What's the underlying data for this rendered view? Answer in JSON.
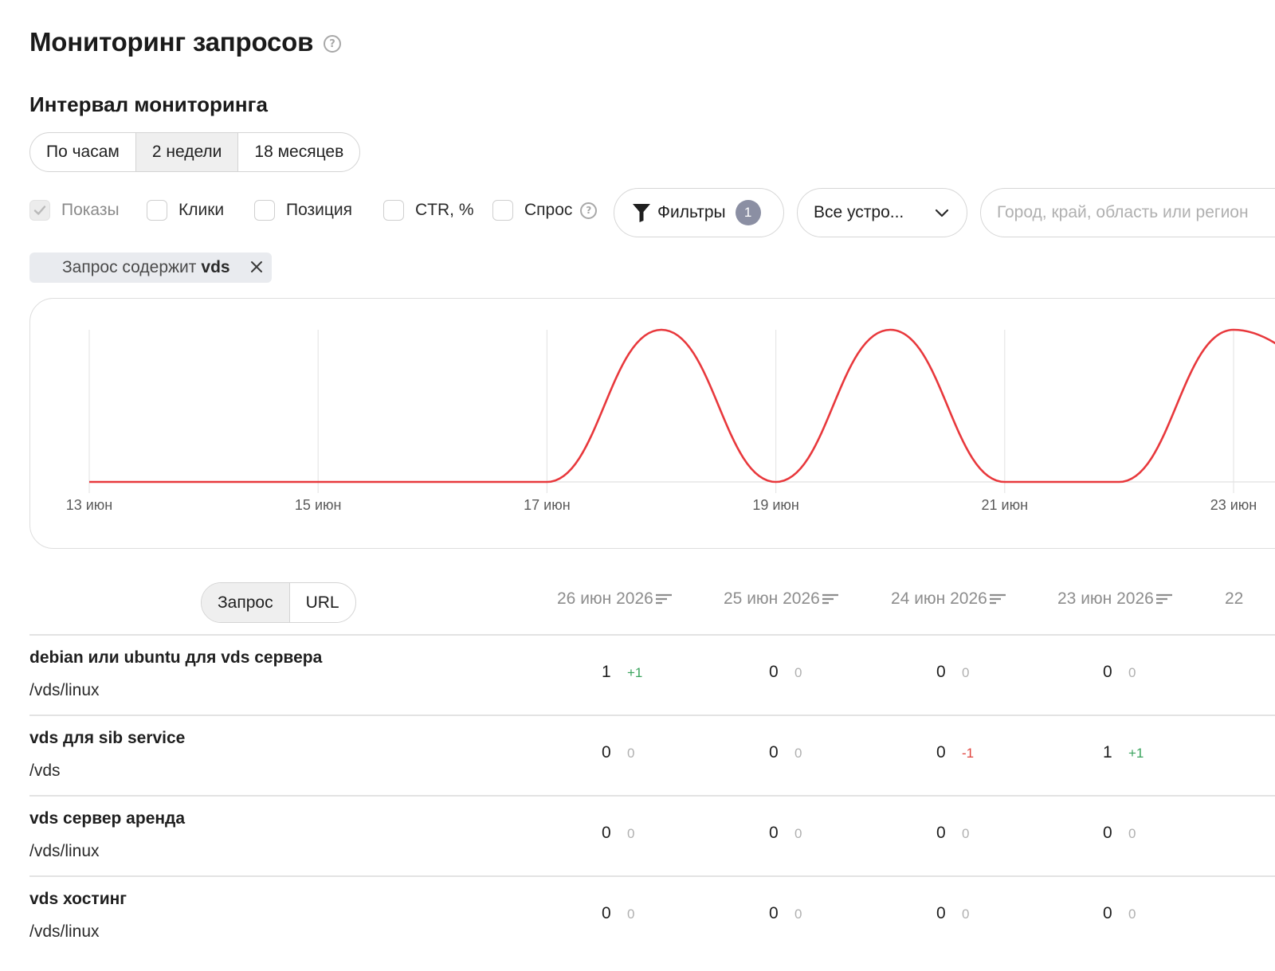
{
  "page": {
    "title": "Мониторинг запросов",
    "help_glyph": "?"
  },
  "interval": {
    "title": "Интервал мониторинга",
    "options": [
      "По часам",
      "2 недели",
      "18 месяцев"
    ],
    "selected": "2 недели"
  },
  "metrics": [
    {
      "label": "Показы",
      "checked": true,
      "disabled": true
    },
    {
      "label": "Клики",
      "checked": false
    },
    {
      "label": "Позиция",
      "checked": false
    },
    {
      "label": "CTR, %",
      "checked": false
    },
    {
      "label": "Спрос",
      "checked": false,
      "has_help": true
    }
  ],
  "filters": {
    "label": "Фильтры",
    "count": "1",
    "icon": "funnel-icon"
  },
  "devices": {
    "value": "Все устро...",
    "icon": "chevron-down-icon"
  },
  "region": {
    "placeholder": "Город, край, область или регион"
  },
  "active_filter": {
    "prefix": "Запрос содержит",
    "value": "vds",
    "close_icon": "close-icon"
  },
  "chart_data": {
    "type": "line",
    "x": [
      "13 июн",
      "14 июн",
      "15 июн",
      "16 июн",
      "17 июн",
      "18 июн",
      "19 июн",
      "20 июн",
      "21 июн",
      "22 июн",
      "23 июн"
    ],
    "x_tick_labels": [
      "13 июн",
      "15 июн",
      "17 июн",
      "19 июн",
      "21 июн",
      "23 июн"
    ],
    "series": [
      {
        "color": "#e8383c",
        "values": [
          0,
          0,
          0,
          0,
          0,
          1,
          0,
          1,
          0,
          0,
          1
        ]
      }
    ],
    "ylim": [
      0,
      1
    ],
    "grid": "vertical",
    "title": "",
    "xlabel": "",
    "ylabel": ""
  },
  "table": {
    "view_options": [
      "Запрос",
      "URL"
    ],
    "view_selected": "Запрос",
    "columns": [
      "26 июн 2026",
      "25 июн 2026",
      "24 июн 2026",
      "23 июн 2026",
      "22"
    ],
    "rows": [
      {
        "query": "debian или ubuntu для vds сервера",
        "url": "/vds/linux",
        "cells": [
          {
            "value": "1",
            "delta": "+1",
            "trend": "pos"
          },
          {
            "value": "0",
            "delta": "0",
            "trend": "zero"
          },
          {
            "value": "0",
            "delta": "0",
            "trend": "zero"
          },
          {
            "value": "0",
            "delta": "0",
            "trend": "zero"
          }
        ]
      },
      {
        "query": "vds для sib service",
        "url": "/vds",
        "cells": [
          {
            "value": "0",
            "delta": "0",
            "trend": "zero"
          },
          {
            "value": "0",
            "delta": "0",
            "trend": "zero"
          },
          {
            "value": "0",
            "delta": "-1",
            "trend": "neg"
          },
          {
            "value": "1",
            "delta": "+1",
            "trend": "pos"
          }
        ]
      },
      {
        "query": "vds сервер аренда",
        "url": "/vds/linux",
        "cells": [
          {
            "value": "0",
            "delta": "0",
            "trend": "zero"
          },
          {
            "value": "0",
            "delta": "0",
            "trend": "zero"
          },
          {
            "value": "0",
            "delta": "0",
            "trend": "zero"
          },
          {
            "value": "0",
            "delta": "0",
            "trend": "zero"
          }
        ]
      },
      {
        "query": "vds хостинг",
        "url": "/vds/linux",
        "cells": [
          {
            "value": "0",
            "delta": "0",
            "trend": "zero"
          },
          {
            "value": "0",
            "delta": "0",
            "trend": "zero"
          },
          {
            "value": "0",
            "delta": "0",
            "trend": "zero"
          },
          {
            "value": "0",
            "delta": "0",
            "trend": "zero"
          }
        ]
      }
    ]
  }
}
